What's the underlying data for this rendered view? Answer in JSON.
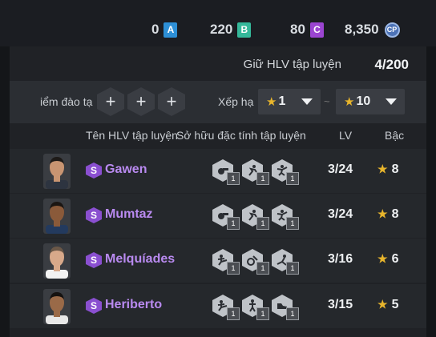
{
  "currencies": [
    {
      "amount": "0",
      "badge": "A",
      "color": "#2d8fd6"
    },
    {
      "amount": "220",
      "badge": "B",
      "color": "#35b89a"
    },
    {
      "amount": "80",
      "badge": "C",
      "color": "#9b45d1"
    },
    {
      "amount": "8,350",
      "badge": "CP",
      "color": "#4c72b6"
    }
  ],
  "slots": {
    "label": "Giữ HLV tập luyện",
    "count": "4/200"
  },
  "filter": {
    "training_label": "iểm đào tạ",
    "add_symbol": "+",
    "sort_label": "Xếp hạ",
    "star_symbol": "★",
    "grade_min": "1",
    "tilde": "~",
    "grade_max": "10"
  },
  "columns": {
    "name": "Tên HLV tập luyện",
    "traits": "Sở hữu đặc tính tập luyện",
    "lv": "LV",
    "grade": "Bậc"
  },
  "coaches": [
    {
      "name": "Gawen",
      "badge": "S",
      "traits": [
        {
          "icon": "whistle-icon",
          "level": "1"
        },
        {
          "icon": "run-icon",
          "level": "1"
        },
        {
          "icon": "jump-icon",
          "level": "1"
        }
      ],
      "lv": "3/24",
      "grade": "8",
      "skin": "#c89572",
      "hair": "#1d1a18",
      "shirt": "#2d3440"
    },
    {
      "name": "Mumtaz",
      "badge": "S",
      "traits": [
        {
          "icon": "whistle-icon",
          "level": "1"
        },
        {
          "icon": "run-icon",
          "level": "1"
        },
        {
          "icon": "jump-icon",
          "level": "1"
        }
      ],
      "lv": "3/24",
      "grade": "8",
      "skin": "#8a5a3a",
      "hair": "#1a1512",
      "shirt": "#233a5e"
    },
    {
      "name": "Melquíades",
      "badge": "S",
      "traits": [
        {
          "icon": "kick-icon",
          "level": "1"
        },
        {
          "icon": "ball-icon",
          "level": "1"
        },
        {
          "icon": "tackle-icon",
          "level": "1"
        }
      ],
      "lv": "3/16",
      "grade": "6",
      "skin": "#d8a98a",
      "hair": "#6b5848",
      "shirt": "#f2f2f2"
    },
    {
      "name": "Heriberto",
      "badge": "S",
      "traits": [
        {
          "icon": "kick-icon",
          "level": "1"
        },
        {
          "icon": "stretch-icon",
          "level": "1"
        },
        {
          "icon": "shoe-icon",
          "level": "1"
        }
      ],
      "lv": "3/15",
      "grade": "5",
      "skin": "#9a6a48",
      "hair": "#151210",
      "shirt": "#e8e8e8"
    }
  ]
}
